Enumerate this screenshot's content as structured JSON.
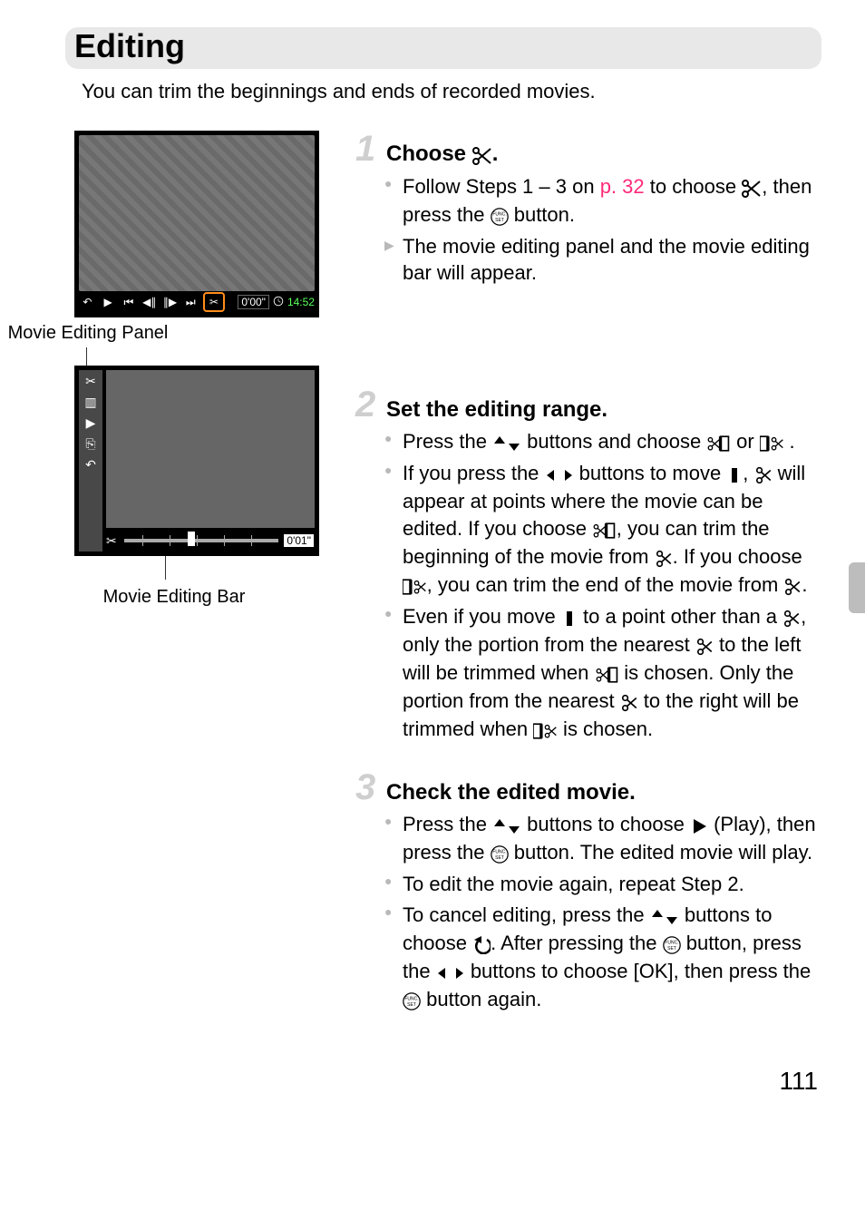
{
  "title": "Editing",
  "intro": "You can trim the beginnings and ends of recorded movies.",
  "left": {
    "caption_panel": "Movie Editing Panel",
    "caption_bar": "Movie Editing Bar",
    "screenshot1": {
      "time_elapsed": "0'00\"",
      "time_total": "14:52"
    },
    "screenshot2": {
      "duration": "0'01\""
    }
  },
  "steps": [
    {
      "num": "1",
      "title_pre": "Choose ",
      "title_post": ".",
      "bullets": [
        {
          "type": "dot",
          "parts": [
            {
              "t": "text",
              "v": "Follow Steps 1 – 3 on "
            },
            {
              "t": "link",
              "v": "p. 32"
            },
            {
              "t": "text",
              "v": " to choose "
            },
            {
              "t": "glyph",
              "v": "scissors"
            },
            {
              "t": "text",
              "v": ", then press the "
            },
            {
              "t": "glyph",
              "v": "funcset"
            },
            {
              "t": "text",
              "v": " button."
            }
          ]
        },
        {
          "type": "tri",
          "parts": [
            {
              "t": "text",
              "v": "The movie editing panel and the movie editing bar will appear."
            }
          ]
        }
      ]
    },
    {
      "num": "2",
      "title_pre": "Set the editing range.",
      "title_post": "",
      "bullets": [
        {
          "type": "dot",
          "parts": [
            {
              "t": "text",
              "v": "Press the "
            },
            {
              "t": "glyph",
              "v": "updown"
            },
            {
              "t": "text",
              "v": " buttons and choose  "
            },
            {
              "t": "glyph",
              "v": "cut-begin"
            },
            {
              "t": "text",
              "v": " or "
            },
            {
              "t": "glyph",
              "v": "cut-end"
            },
            {
              "t": "text",
              "v": " ."
            }
          ]
        },
        {
          "type": "dot",
          "parts": [
            {
              "t": "text",
              "v": "If you press the "
            },
            {
              "t": "glyph",
              "v": "leftright"
            },
            {
              "t": "text",
              "v": " buttons to move "
            },
            {
              "t": "glyph",
              "v": "handle"
            },
            {
              "t": "text",
              "v": ", "
            },
            {
              "t": "glyph",
              "v": "cut-mark"
            },
            {
              "t": "text",
              "v": " will appear at points where the movie can be edited. If you choose  "
            },
            {
              "t": "glyph",
              "v": "cut-begin"
            },
            {
              "t": "text",
              "v": ", you can trim the beginning of the movie from  "
            },
            {
              "t": "glyph",
              "v": "cut-mark"
            },
            {
              "t": "text",
              "v": ". If you choose  "
            },
            {
              "t": "glyph",
              "v": "cut-end"
            },
            {
              "t": "text",
              "v": ", you can trim the end of the movie from  "
            },
            {
              "t": "glyph",
              "v": "cut-mark"
            },
            {
              "t": "text",
              "v": "."
            }
          ]
        },
        {
          "type": "dot",
          "parts": [
            {
              "t": "text",
              "v": "Even if you move "
            },
            {
              "t": "glyph",
              "v": "handle"
            },
            {
              "t": "text",
              "v": " to a point other than a "
            },
            {
              "t": "glyph",
              "v": "cut-mark"
            },
            {
              "t": "text",
              "v": ", only the portion from the nearest "
            },
            {
              "t": "glyph",
              "v": "cut-mark"
            },
            {
              "t": "text",
              "v": " to the left will be trimmed when  "
            },
            {
              "t": "glyph",
              "v": "cut-begin"
            },
            {
              "t": "text",
              "v": " is chosen. Only the portion from the nearest "
            },
            {
              "t": "glyph",
              "v": "cut-mark"
            },
            {
              "t": "text",
              "v": " to the right will be trimmed when "
            },
            {
              "t": "glyph",
              "v": "cut-end"
            },
            {
              "t": "text",
              "v": " is chosen."
            }
          ]
        }
      ]
    },
    {
      "num": "3",
      "title_pre": "Check the edited movie.",
      "title_post": "",
      "bullets": [
        {
          "type": "dot",
          "parts": [
            {
              "t": "text",
              "v": "Press the "
            },
            {
              "t": "glyph",
              "v": "updown"
            },
            {
              "t": "text",
              "v": " buttons to choose  "
            },
            {
              "t": "glyph",
              "v": "play"
            },
            {
              "t": "text",
              "v": " (Play), then press the "
            },
            {
              "t": "glyph",
              "v": "funcset"
            },
            {
              "t": "text",
              "v": " button. The edited movie will play."
            }
          ]
        },
        {
          "type": "dot",
          "parts": [
            {
              "t": "text",
              "v": "To edit the movie again, repeat Step 2."
            }
          ]
        },
        {
          "type": "dot",
          "parts": [
            {
              "t": "text",
              "v": "To cancel editing, press the "
            },
            {
              "t": "glyph",
              "v": "updown"
            },
            {
              "t": "text",
              "v": " buttons to choose  "
            },
            {
              "t": "glyph",
              "v": "back"
            },
            {
              "t": "text",
              "v": ". After pressing the "
            },
            {
              "t": "glyph",
              "v": "funcset"
            },
            {
              "t": "text",
              "v": " button, press the "
            },
            {
              "t": "glyph",
              "v": "leftright"
            },
            {
              "t": "text",
              "v": " buttons to choose [OK], then press the "
            },
            {
              "t": "glyph",
              "v": "funcset"
            },
            {
              "t": "text",
              "v": " button again."
            }
          ]
        }
      ]
    }
  ],
  "page_number": "111"
}
